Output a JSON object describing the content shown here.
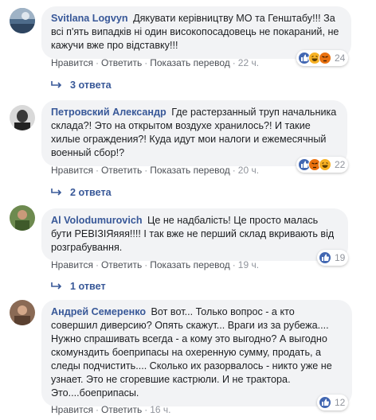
{
  "comments": [
    {
      "author": "Svitlana Logvyn",
      "text": "Дякувати керівництву МО та Генштабу!!! За всі п'ять випадків ні один високопосадовець не покараний, не кажучи вже про відставку!!!",
      "like": "Нравится",
      "reply": "Ответить",
      "translate": "Показать перевод",
      "time": "22 ч.",
      "react_count": "24",
      "react_icons": [
        "like-icon",
        "haha-icon",
        "angry-icon"
      ],
      "replies": "3 ответа"
    },
    {
      "author": "Петровский Александр",
      "text": "Где растерзанный труп начальника склада?! Это на открытом воздухе хранилось?! И такие хилые ограждения?! Куда идут мои налоги и ежемесячный военный сбор!?",
      "like": "Нравится",
      "reply": "Ответить",
      "translate": "Показать перевод",
      "time": "20 ч.",
      "react_count": "22",
      "react_icons": [
        "like-icon",
        "angry-icon",
        "haha-icon"
      ],
      "replies": "2 ответа"
    },
    {
      "author": "Al Volodumurovich",
      "text": "Це не надбалість! Це просто малась бути РЕВІЗІЯяяя!!!! І так вже не перший склад вкривають від розграбування.",
      "like": "Нравится",
      "reply": "Ответить",
      "translate": "Показать перевод",
      "time": "19 ч.",
      "react_count": "19",
      "react_icons": [
        "like-icon"
      ],
      "replies": "1 ответ"
    },
    {
      "author": "Андрей Семеренко",
      "text": "Вот вот... Только вопрос - а кто совершил диверсию? Опять скажут... Враги из за рубежа.... Нужно спрашивать всегда - а кому это выгодно? А выгодно скомунздить боеприпасы на охеренную сумму, продать, а следы подчистить.... Сколько их разорвалось - никто уже не узнает. Это не сгоревшие кастрюли. И не трактора. Это....боеприпасы.",
      "like": "Нравится",
      "reply": "Ответить",
      "time": "16 ч.",
      "react_count": "12",
      "react_icons": [
        "like-icon"
      ]
    }
  ],
  "colors": {
    "link": "#385898",
    "bubble": "#f2f3f5",
    "meta": "#90949c",
    "like_blue": "#4267b2",
    "haha_yellow": "#f7b125",
    "angry_orange": "#e9710f"
  }
}
